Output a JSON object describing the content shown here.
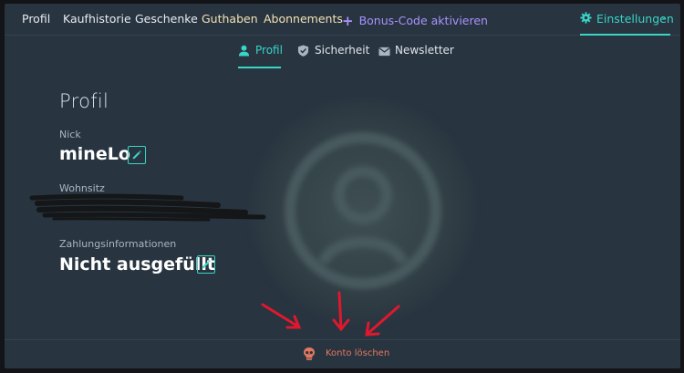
{
  "topnav": {
    "items": [
      {
        "label": "Profil",
        "style": "normal"
      },
      {
        "label": "Kaufhistorie",
        "style": "normal"
      },
      {
        "label": "Geschenke",
        "style": "normal"
      },
      {
        "label": "Guthaben",
        "style": "gold"
      },
      {
        "label": "Abonnements",
        "style": "gold"
      },
      {
        "label": "Bonus-Code aktivieren",
        "style": "purple"
      }
    ],
    "settings_label": "Einstellungen"
  },
  "subnav": {
    "tabs": [
      {
        "label": "Profil",
        "icon": "user-icon",
        "active": true
      },
      {
        "label": "Sicherheit",
        "icon": "shield-icon",
        "active": false
      },
      {
        "label": "Newsletter",
        "icon": "envelope-icon",
        "active": false
      }
    ]
  },
  "profile": {
    "title": "Profil",
    "nick_label": "Nick",
    "nick_value": "mineLo",
    "residence_label": "Wohnsitz",
    "payment_label": "Zahlungsinformationen",
    "payment_value": "Nicht ausgefüllt"
  },
  "footer": {
    "delete_label": "Konto löschen"
  },
  "colors": {
    "background": "#283440",
    "accent": "#39d5c7",
    "gold": "#f3e3b5",
    "purple": "#a993ff",
    "danger": "#e2795f",
    "annotation_arrow": "#e0182d"
  }
}
